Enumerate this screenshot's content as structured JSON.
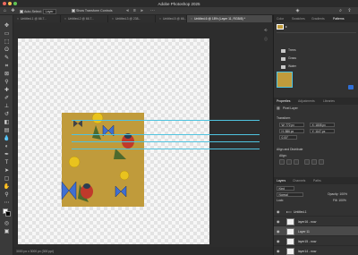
{
  "app": {
    "title": "Adobe Photoshop 2025"
  },
  "colors": {
    "accent": "#4fc3e0",
    "pattern_bg": "#c09b3b",
    "selected_layer": "#4a4a4a",
    "primary_button": "#2f6fd6"
  },
  "options_bar": {
    "auto_select_label": "Auto-Select:",
    "auto_select_value": "Layer",
    "show_transform_label": "Show Transform Controls"
  },
  "tabs": [
    {
      "label": "Untitled-1 @ 66.7...",
      "active": false
    },
    {
      "label": "Untitled-2 @ 66.7...",
      "active": false
    },
    {
      "label": "Untitled-3 @ 238...",
      "active": false
    },
    {
      "label": "Untitled-5 @ 66...",
      "active": false
    },
    {
      "label": "Untitled-6 @ 18% (Layer 11, RGB/8) *",
      "active": true
    }
  ],
  "status": {
    "text": "3000 px x 3000 px (300 ppi)"
  },
  "panels": {
    "top_tabs": [
      "Color",
      "Swatches",
      "Gradients",
      "Patterns"
    ],
    "pattern_folders": [
      "Trees",
      "Grass",
      "Water"
    ],
    "properties_tabs": [
      "Properties",
      "Adjustments",
      "Libraries"
    ],
    "pixel_layer_label": "Pixel Layer",
    "transform_label": "Transform",
    "transform": {
      "w": "W: 772 px",
      "h": "H: 886 px",
      "x": "X: 1808 px",
      "y": "Y: 1147 px",
      "angle": "0.00°"
    },
    "align_label": "Align and Distribute",
    "align_sub": "Align:",
    "layers_tabs": [
      "Layers",
      "Channels",
      "Paths"
    ],
    "kind_label": "Kind",
    "blend_mode": "Normal",
    "opacity_label": "Opacity: 100%",
    "lock_label": "Lock:",
    "fill_label": "Fill: 100%",
    "layers": [
      {
        "name": "Untitled-1",
        "selected": false
      },
      {
        "name": "layer16 - now",
        "selected": false
      },
      {
        "name": "Layer 11",
        "selected": true
      },
      {
        "name": "layer15 - now",
        "selected": false
      },
      {
        "name": "layer14 - now",
        "selected": false
      }
    ]
  }
}
